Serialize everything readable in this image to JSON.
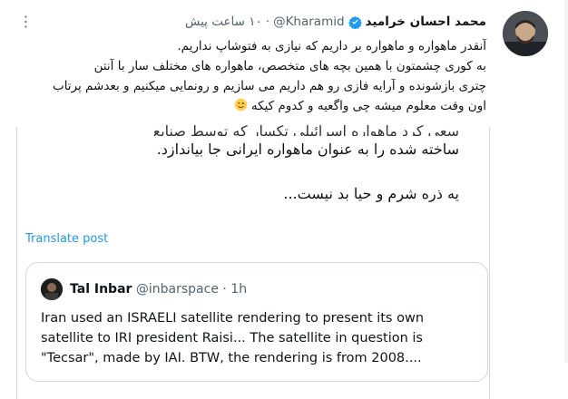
{
  "post": {
    "author": {
      "display_name": "محمد احسان خرامید",
      "handle": "@Kharamid",
      "timestamp": "۱۰ ساعت پیش",
      "separator": "·"
    },
    "more_label": "⋮",
    "text": {
      "line1": "آنقدر ماهواره و ماهواره بر داریم که نیازی به فتوشاپ نداریم.",
      "line2": "به کوری چشمتون با همین بچه های متخصص، ماهواره های مختلف سار با آنتن",
      "line3": "چتری بازشونده و آرایه فازی رو هم داریم می سازیم و رونمایی میکنیم و بعدشم پرتاب",
      "line4": "اون وقت معلوم میشه چی واگعیه و کدوم کیکه"
    },
    "media": {
      "cut_line": "سعی کرد ماهواره اسرائیلی تکسار که توسط صنایع هوافضای اسرائیل",
      "line1": "ساخته شده را به عنوان ماهواره ایرانی جا بیاندازد.",
      "line2": "یه ذره شرم و حیا بد نیست..."
    },
    "translate_label": "Translate post",
    "quote": {
      "name": "Tal Inbar",
      "handle": "@inbarspace",
      "separator": "·",
      "time": "1h",
      "body_line1": "Iran used an ISRAELI satellite rendering to present its own",
      "body_line2": "satellite to IRI president Raisi... The satellite in question is",
      "body_line3": "\"Tecsar\", made by IAI. BTW, the rendering is from 2008...."
    }
  },
  "colors": {
    "link": "#1d9bf0",
    "verified": "#1d9bf0",
    "muted": "#536471",
    "border": "#cfd9de"
  }
}
